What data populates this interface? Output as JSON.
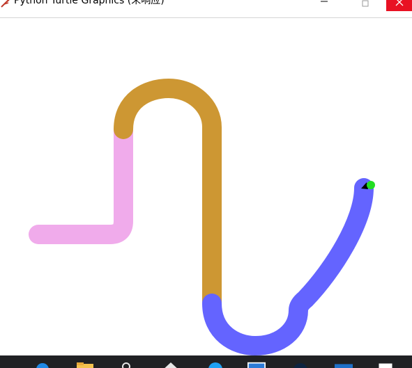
{
  "window": {
    "title": "Python Turtle Graphics (未响应)"
  },
  "canvas": {
    "stroke_width": 28,
    "background": "#ffffff",
    "paths": [
      {
        "name": "pink-path",
        "color": "#f0abeb"
      },
      {
        "name": "gold-path",
        "color": "#cd9733"
      },
      {
        "name": "blue-path",
        "color": "#6464ff"
      }
    ],
    "turtle": {
      "color": "#22dd22"
    }
  },
  "colors": {
    "close_button": "#e81123",
    "taskbar": "#202124"
  },
  "taskbar": {
    "icons": [
      "edge-icon",
      "file-explorer-icon",
      "search-icon",
      "steam-icon",
      "browser-icon",
      "window-icon",
      "photoshop-icon",
      "word-icon",
      "notepad-icon"
    ]
  }
}
